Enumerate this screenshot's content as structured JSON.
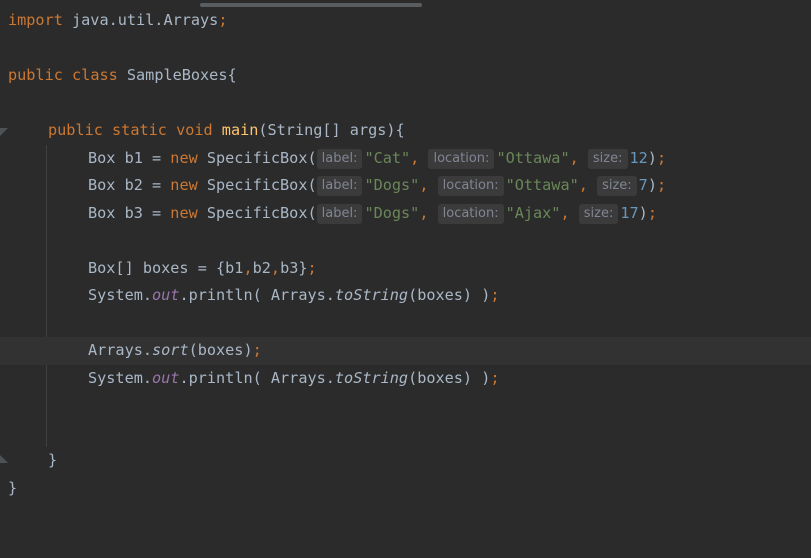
{
  "colors": {
    "background": "#2b2b2b",
    "keyword": "#cc7832",
    "method_declaration": "#ffc66d",
    "string": "#6a8759",
    "number": "#6897bb",
    "static_field": "#9876aa",
    "plain": "#a9b7c6",
    "hint_text": "#818594",
    "hint_background": "#3b3b3b"
  },
  "code": {
    "l1": {
      "kw": "import",
      "rest": " java.util.Arrays",
      "semi": ";"
    },
    "l3": {
      "kw1": "public",
      "kw2": "class",
      "rest": " SampleBoxes{"
    },
    "l5": {
      "kw1": "public",
      "kw2": "static",
      "kw3": "void",
      "method": "main",
      "rest": "(String[] args){"
    },
    "l6": {
      "head": "Box b1 = ",
      "kw": "new",
      "ctor": " SpecificBox(",
      "hint_label": "label:",
      "v_label": "\"Cat\"",
      "comma1": ",",
      "hint_location": "location:",
      "v_location": "\"Ottawa\"",
      "comma2": ",",
      "hint_size": "size:",
      "v_size": "12",
      "tail": ")",
      "semi": ";"
    },
    "l7": {
      "head": "Box b2 = ",
      "kw": "new",
      "ctor": " SpecificBox(",
      "hint_label": "label:",
      "v_label": "\"Dogs\"",
      "comma1": ",",
      "hint_location": "location:",
      "v_location": "\"Ottawa\"",
      "comma2": ",",
      "hint_size": "size:",
      "v_size": "7",
      "tail": ")",
      "semi": ";"
    },
    "l8": {
      "head": "Box b3 = ",
      "kw": "new",
      "ctor": " SpecificBox(",
      "hint_label": "label:",
      "v_label": "\"Dogs\"",
      "comma1": ",",
      "hint_location": "location:",
      "v_location": "\"Ajax\"",
      "comma2": ",",
      "hint_size": "size:",
      "v_size": "17",
      "tail": ")",
      "semi": ";"
    },
    "l10": {
      "head": "Box[] boxes = {b1",
      "c1": ",",
      "mid1": "b2",
      "c2": ",",
      "mid2": "b3}",
      "semi": ";"
    },
    "l11": {
      "head": "System.",
      "field": "out",
      "mid": ".println( Arrays.",
      "call": "toString",
      "tail": "(boxes) )",
      "semi": ";"
    },
    "l13": {
      "head": "Arrays.",
      "call": "sort",
      "tail": "(boxes)",
      "semi": ";"
    },
    "l14": {
      "head": "System.",
      "field": "out",
      "mid": ".println( Arrays.",
      "call": "toString",
      "tail": "(boxes) )",
      "semi": ";"
    },
    "l17": {
      "text": "}"
    },
    "l18": {
      "text": "}"
    }
  }
}
